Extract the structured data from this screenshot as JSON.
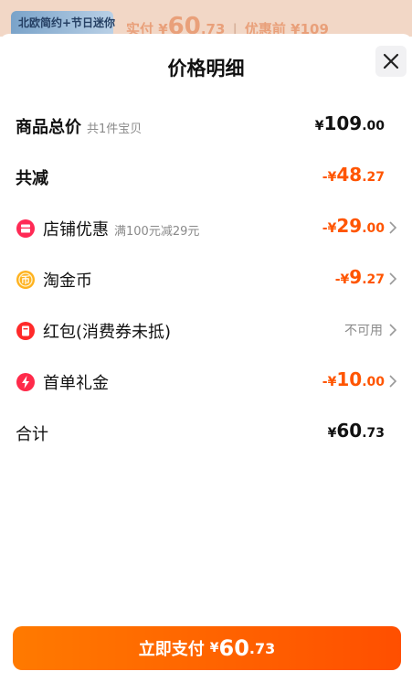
{
  "backdrop": {
    "thumb_text": "北欧简约+节日迷你",
    "paid_label": "实付 ¥",
    "paid_int": "60",
    "paid_dec": ".73",
    "before_label": "优惠前 ¥109"
  },
  "sheet": {
    "title": "价格明细",
    "close_icon": "close-icon"
  },
  "rows": {
    "total": {
      "label": "商品总价",
      "sub": "共1件宝贝",
      "sym": "¥",
      "int": "109",
      "dec": ".00"
    },
    "discount": {
      "label": "共减",
      "sym": "-¥",
      "int": "48",
      "dec": ".27"
    },
    "shop": {
      "label": "店铺优惠",
      "sub": "满100元减29元",
      "sym": "-¥",
      "int": "29",
      "dec": ".00",
      "icon": "shop-coupon-icon"
    },
    "coin": {
      "label": "淘金币",
      "sym": "-¥",
      "int": "9",
      "dec": ".27",
      "icon": "coin-icon"
    },
    "redpacket": {
      "label": "红包(消费券未抵)",
      "value": "不可用",
      "icon": "red-packet-icon"
    },
    "firstorder": {
      "label": "首单礼金",
      "sym": "-¥",
      "int": "10",
      "dec": ".00",
      "icon": "lightning-icon"
    },
    "sum": {
      "label": "合计",
      "sym": "¥",
      "int": "60",
      "dec": ".73"
    }
  },
  "pay": {
    "label": "立即支付",
    "sym": "¥",
    "int": "60",
    "dec": ".73"
  },
  "colors": {
    "accent": "#ff5500",
    "button": "#ff5a00",
    "muted": "#8a8a8a"
  }
}
